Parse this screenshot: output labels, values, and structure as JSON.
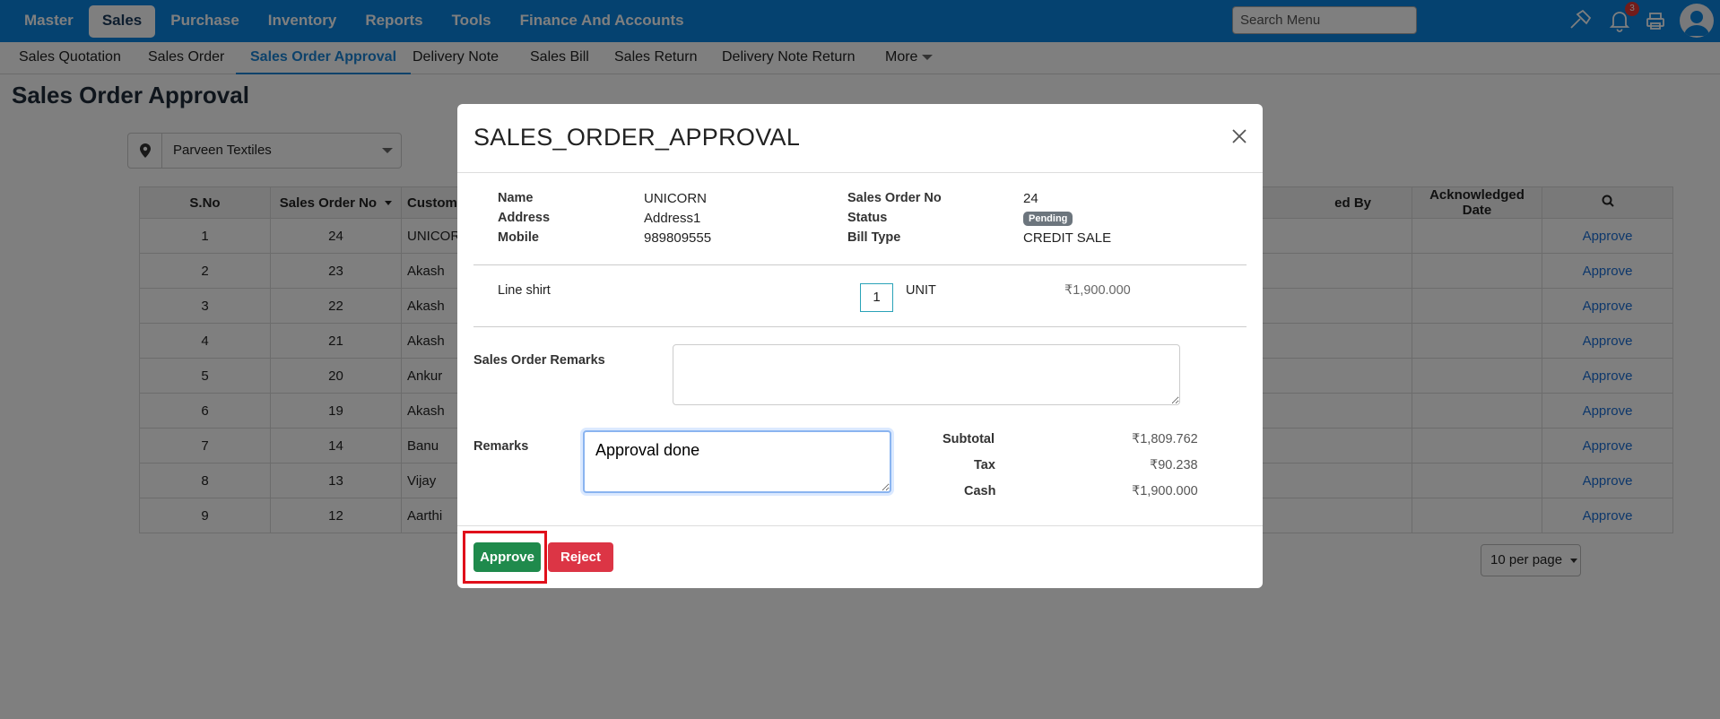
{
  "topnav": {
    "items": [
      "Master",
      "Sales",
      "Purchase",
      "Inventory",
      "Reports",
      "Tools",
      "Finance And Accounts"
    ],
    "active": "Sales",
    "search_placeholder": "Search Menu",
    "notification_count": "3"
  },
  "subnav": {
    "items": [
      "Sales Quotation",
      "Sales Order",
      "Sales Order Approval",
      "Delivery Note",
      "Sales Bill",
      "Sales Return",
      "Delivery Note Return",
      "More"
    ],
    "active": "Sales Order Approval"
  },
  "page": {
    "title": "Sales Order Approval",
    "location": "Parveen Textiles",
    "table": {
      "headers": [
        "S.No",
        "Sales Order No",
        "Custome",
        "ed By",
        "Acknowledged Date"
      ],
      "rows": [
        [
          "1",
          "24",
          "UNICOR"
        ],
        [
          "2",
          "23",
          "Akash"
        ],
        [
          "3",
          "22",
          "Akash"
        ],
        [
          "4",
          "21",
          "Akash"
        ],
        [
          "5",
          "20",
          "Ankur"
        ],
        [
          "6",
          "19",
          "Akash"
        ],
        [
          "7",
          "14",
          "Banu"
        ],
        [
          "8",
          "13",
          "Vijay"
        ],
        [
          "9",
          "12",
          "Aarthi"
        ]
      ],
      "action_label": "Approve"
    },
    "per_page": "10 per page"
  },
  "modal": {
    "title": "SALES_ORDER_APPROVAL",
    "name_label": "Name",
    "name_value": "UNICORN",
    "address_label": "Address",
    "address_value": "Address1",
    "mobile_label": "Mobile",
    "mobile_value": "989809555",
    "order_no_label": "Sales Order No",
    "order_no_value": "24",
    "status_label": "Status",
    "status_value": "Pending",
    "bill_type_label": "Bill Type",
    "bill_type_value": "CREDIT SALE",
    "item_name": "Line shirt",
    "item_qty": "1",
    "item_unit": "UNIT",
    "item_price": "₹1,900.000",
    "sales_order_remarks_label": "Sales Order Remarks",
    "remarks_label": "Remarks",
    "remarks_value": "Approval done",
    "subtotal_label": "Subtotal",
    "subtotal_value": "₹1,809.762",
    "tax_label": "Tax",
    "tax_value": "₹90.238",
    "cash_label": "Cash",
    "cash_value": "₹1,900.000",
    "approve_label": "Approve",
    "reject_label": "Reject"
  },
  "colors": {
    "brand": "#0a84e0",
    "approve": "#1f8a4c",
    "reject": "#dc3545",
    "highlight": "#e0101b"
  }
}
